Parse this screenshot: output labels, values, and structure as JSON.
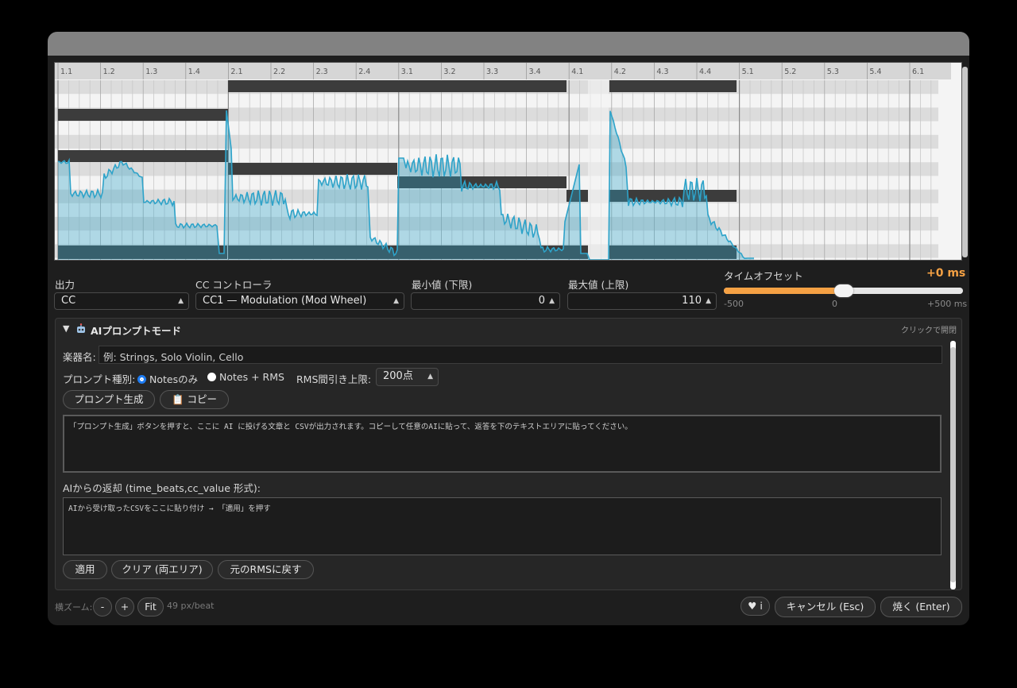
{
  "ruler": {
    "labels": [
      "1.1",
      "1.2",
      "1.3",
      "1.4",
      "2.1",
      "2.2",
      "2.3",
      "2.4",
      "3.1",
      "3.2",
      "3.3",
      "3.4",
      "4.1",
      "4.2",
      "4.3",
      "4.4",
      "5.1",
      "5.2",
      "5.3",
      "5.4",
      "6.1"
    ]
  },
  "output": {
    "label": "出力",
    "value": "CC"
  },
  "cc_controller": {
    "label": "CC コントローラ",
    "value": "CC1 — Modulation (Mod Wheel)"
  },
  "min_value": {
    "label": "最小値 (下限)",
    "value": "0"
  },
  "max_value": {
    "label": "最大値 (上限)",
    "value": "110"
  },
  "time_offset": {
    "label": "タイムオフセット",
    "value": "+0 ms",
    "min_label": "-500",
    "mid_label": "0",
    "max_label": "+500 ms",
    "level": 0.5
  },
  "ai_panel": {
    "title": "AIプロンプトモード",
    "toggle_glyph": "▼",
    "icon": "robot-icon",
    "toggle_hint": "クリックで開閉",
    "instrument": {
      "label": "楽器名:",
      "placeholder": "例: Strings, Solo Violin, Cello"
    },
    "prompt_type": {
      "label": "プロンプト種別:",
      "option_notes": "Notesのみ",
      "option_rms": "Notes + RMS"
    },
    "rms_limit": {
      "label": "RMS間引き上限:",
      "value": "200点"
    },
    "generate_button": "プロンプト生成",
    "copy_button": "📋 コピー",
    "prompt_output_text": "「プロンプト生成」ボタンを押すと、ここに AI に投げる文章と CSVが出力されます。コピーして任意のAIに貼って、返答を下のテキストエリアに貼ってください。",
    "response_label": "AIからの返却 (time_beats,cc_value 形式):",
    "response_text": "AIから受け取ったCSVをここに貼り付け → 「適用」を押す",
    "apply_button": "適用",
    "clear_button": "クリア (両エリア)",
    "restore_button": "元のRMSに戻す"
  },
  "footer": {
    "zoom_label": "横ズーム:",
    "zoom_out": "-",
    "zoom_in": "+",
    "fit": "Fit",
    "zoom_value": "49 px/beat",
    "heart_button": "♥ i",
    "cancel_button": "キャンセル (Esc)",
    "bake_button": "焼く (Enter)"
  },
  "colors": {
    "accent_orange": "#f5a144",
    "curve_blue": "#2ea3c9",
    "note_bar": "#3c3c3c",
    "radio_selected": "#1e7cf2"
  }
}
